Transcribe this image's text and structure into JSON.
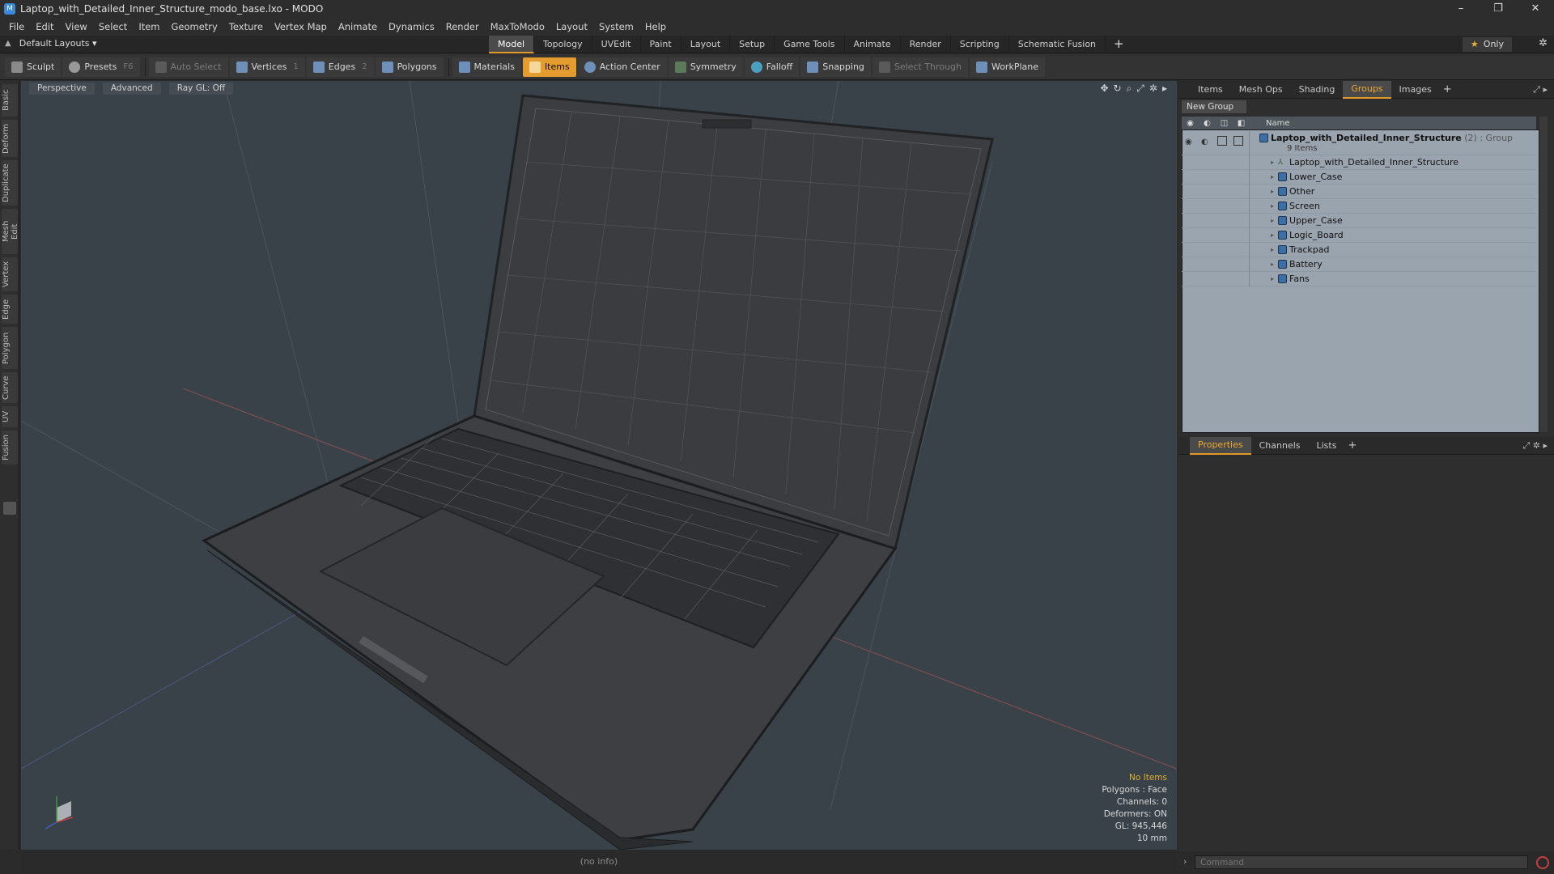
{
  "window": {
    "title": "Laptop_with_Detailed_Inner_Structure_modo_base.lxo - MODO",
    "app_icon": "modo-icon",
    "controls": [
      "–",
      "❐",
      "✕"
    ]
  },
  "menu": [
    "File",
    "Edit",
    "View",
    "Select",
    "Item",
    "Geometry",
    "Texture",
    "Vertex Map",
    "Animate",
    "Dynamics",
    "Render",
    "MaxToModo",
    "Layout",
    "System",
    "Help"
  ],
  "layoutbar": {
    "layouts": "Default Layouts ▾",
    "tabs": [
      "Model",
      "Topology",
      "UVEdit",
      "Paint",
      "Layout",
      "Setup",
      "Game Tools",
      "Animate",
      "Render",
      "Scripting",
      "Schematic Fusion"
    ],
    "active_tab": "Model",
    "only": "Only"
  },
  "toolbar": {
    "sculpt": "Sculpt",
    "presets": "Presets",
    "presets_key": "F6",
    "auto_select": "Auto Select",
    "vertices": "Vertices",
    "vertices_key": "1",
    "edges": "Edges",
    "edges_key": "2",
    "polygons": "Polygons",
    "materials": "Materials",
    "items": "Items",
    "action_center": "Action Center",
    "symmetry": "Symmetry",
    "falloff": "Falloff",
    "snapping": "Snapping",
    "select_through": "Select Through",
    "workplane": "WorkPlane"
  },
  "lefttabs": [
    "Basic",
    "Deform",
    "Duplicate",
    "Mesh Edit",
    "Vertex",
    "Edge",
    "Polygon",
    "Curve",
    "UV",
    "Fusion"
  ],
  "viewport": {
    "view": "Perspective",
    "shading": "Advanced",
    "raygl": "Ray GL: Off",
    "stats": {
      "no_items": "No Items",
      "polygons": "Polygons : Face",
      "channels": "Channels: 0",
      "deformers": "Deformers: ON",
      "gl": "GL: 945,446",
      "unit": "10 mm"
    }
  },
  "statusbar": "(no info)",
  "panel_top": {
    "tabs": [
      "Items",
      "Mesh Ops",
      "Shading",
      "Groups",
      "Images"
    ],
    "active": "Groups",
    "new_group": "New Group",
    "col_name": "Name",
    "root": {
      "name": "Laptop_with_Detailed_Inner_Structure",
      "count": "(2)",
      "type": ": Group",
      "sub": "9 Items"
    },
    "items": [
      "Laptop_with_Detailed_Inner_Structure",
      "Lower_Case",
      "Other",
      "Screen",
      "Upper_Case",
      "Logic_Board",
      "Trackpad",
      "Battery",
      "Fans"
    ]
  },
  "panel_bottom": {
    "tabs": [
      "Properties",
      "Channels",
      "Lists"
    ],
    "active": "Properties"
  },
  "command": {
    "placeholder": "Command"
  }
}
